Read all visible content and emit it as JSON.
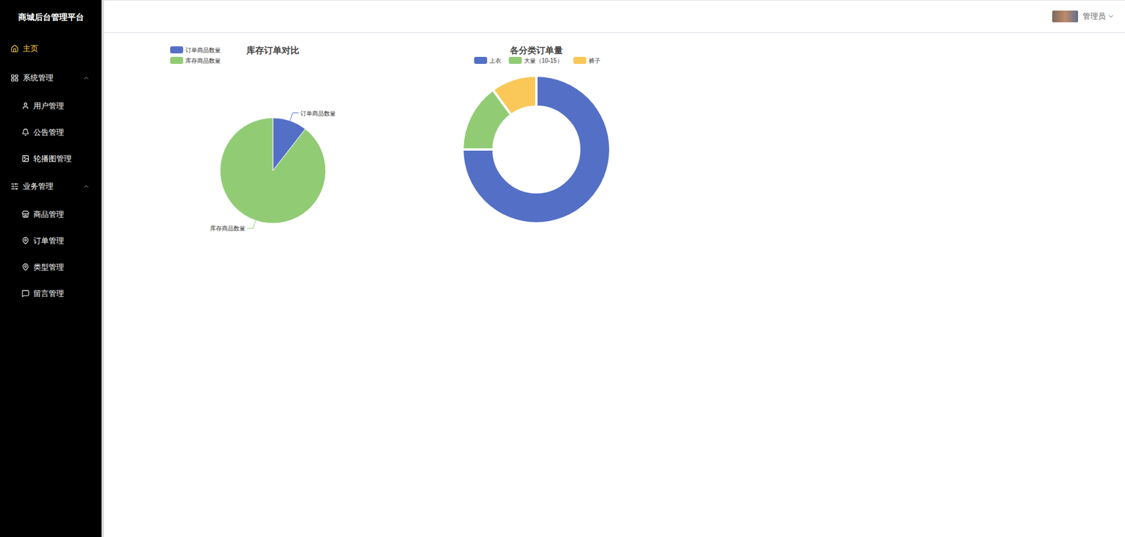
{
  "app": {
    "title": "商城后台管理平台"
  },
  "sidebar": {
    "items": [
      {
        "label": "主页",
        "kind": "item",
        "selected": true,
        "expanded": false
      },
      {
        "label": "系统管理",
        "kind": "group",
        "selected": false,
        "expanded": true
      },
      {
        "label": "用户管理",
        "kind": "subitem",
        "selected": false,
        "expanded": false
      },
      {
        "label": "公告管理",
        "kind": "subitem",
        "selected": false,
        "expanded": false
      },
      {
        "label": "轮播图管理",
        "kind": "subitem",
        "selected": false,
        "expanded": false
      },
      {
        "label": "业务管理",
        "kind": "group",
        "selected": false,
        "expanded": true
      },
      {
        "label": "商品管理",
        "kind": "subitem",
        "selected": false,
        "expanded": false
      },
      {
        "label": "订单管理",
        "kind": "subitem",
        "selected": false,
        "expanded": false
      },
      {
        "label": "类型管理",
        "kind": "subitem",
        "selected": false,
        "expanded": false
      },
      {
        "label": "留言管理",
        "kind": "subitem",
        "selected": false,
        "expanded": false
      }
    ]
  },
  "header": {
    "user": "管理员"
  },
  "charts": [
    {
      "title": "库存订单对比",
      "kind": "pie",
      "series": [
        {
          "name": "订单商品数量",
          "value": 10,
          "color": "#5470c6"
        },
        {
          "name": "库存商品数量",
          "value": 85,
          "color": "#91cc75"
        }
      ]
    },
    {
      "title": "各分类订单量",
      "kind": "donut",
      "series": [
        {
          "name": "上衣",
          "value": 15,
          "color": "#5470c6"
        },
        {
          "name": "大量（10-15）",
          "value": 3,
          "color": "#91cc75"
        },
        {
          "name": "裤子",
          "value": 2,
          "color": "#fac858"
        }
      ]
    }
  ]
}
